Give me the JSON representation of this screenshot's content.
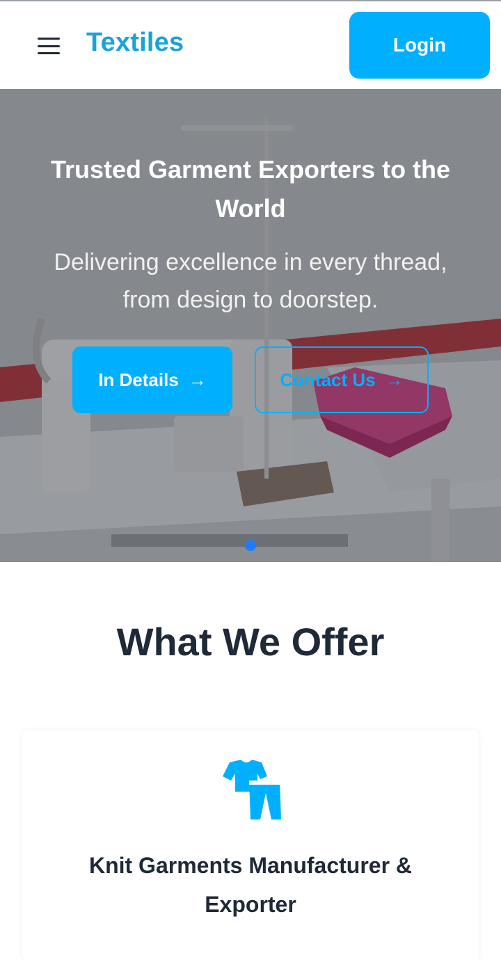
{
  "header": {
    "brand": "Textiles",
    "login_label": "Login"
  },
  "hero": {
    "title": "Trusted Garment Exporters to the World",
    "subtitle": "Delivering excellence in every thread, from design to doorstep.",
    "primary_button": "In Details",
    "secondary_button": "Contact Us",
    "arrow": "→"
  },
  "offers": {
    "heading": "What We Offer",
    "cards": [
      {
        "title": "Knit Garments Manufacturer & Exporter",
        "icon": "clothes-icon"
      }
    ]
  },
  "colors": {
    "accent": "#00b0ff",
    "brand": "#19a3db",
    "heading": "#1f2937",
    "carousel_dot": "#1e7bff"
  }
}
